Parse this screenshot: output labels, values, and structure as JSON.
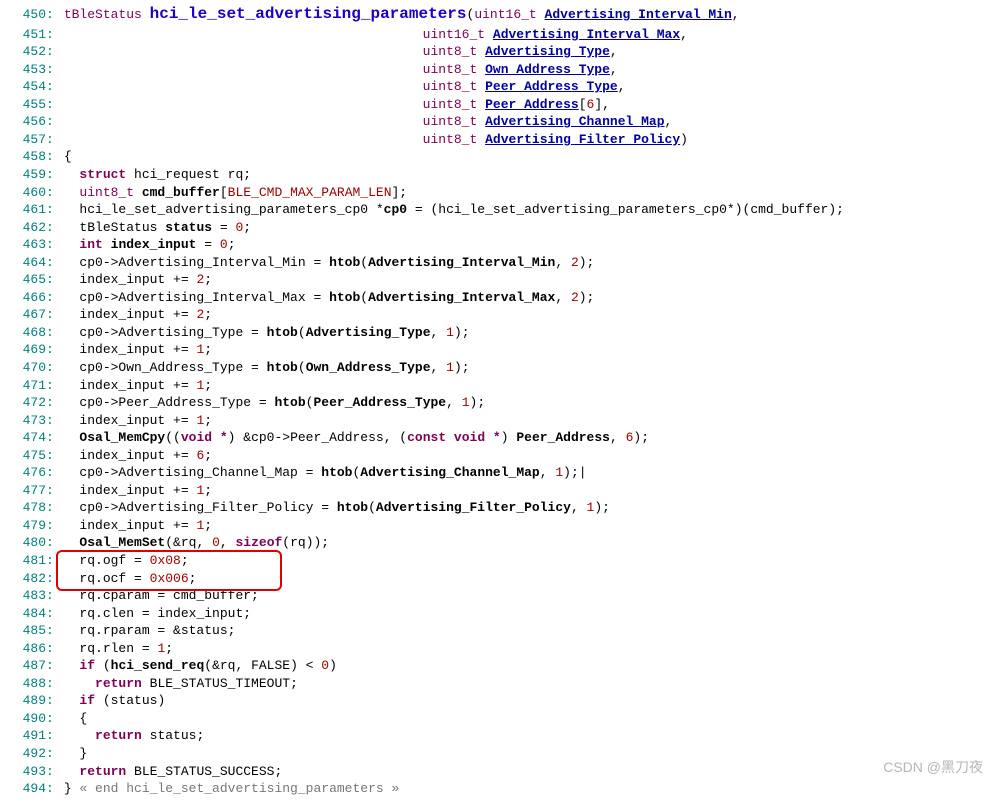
{
  "watermark": "CSDN @黑刀夜",
  "parameters": [
    {
      "type": "uint16_t",
      "name": "Advertising_Interval_Min"
    },
    {
      "type": "uint16_t",
      "name": "Advertising_Interval_Max"
    },
    {
      "type": "uint8_t",
      "name": "Advertising_Type"
    },
    {
      "type": "uint8_t",
      "name": "Own_Address_Type"
    },
    {
      "type": "uint8_t",
      "name": "Peer_Address_Type"
    },
    {
      "type": "uint8_t",
      "name": "Peer_Address",
      "array": "[6]"
    },
    {
      "type": "uint8_t",
      "name": "Advertising_Channel_Map"
    },
    {
      "type": "uint8_t",
      "name": "Advertising_Filter_Policy"
    }
  ],
  "lines": {
    "450": {
      "ret": "tBleStatus",
      "func": "hci_le_set_advertising_parameters"
    },
    "459": {
      "kw": "struct",
      "rest": " hci_request rq;"
    },
    "460": {
      "type": "uint8_t",
      "ident": " cmd_buffer",
      "macro": "BLE_CMD_MAX_PARAM_LEN"
    },
    "461": {
      "cast_type": "hci_le_set_advertising_parameters_cp0 *",
      "ident": "cp0",
      "rhs": "(hci_le_set_advertising_parameters_cp0*)(cmd_buffer);"
    },
    "462": {
      "type": "tBleStatus ",
      "ident": "status",
      "rhs": " = ",
      "num": "0"
    },
    "463": {
      "kw": "int ",
      "ident": "index_input",
      "rhs": " = ",
      "num": "0"
    },
    "464": {
      "lhs": "cp0->Advertising_Interval_Min = ",
      "fn": "htob",
      "arg": "Advertising_Interval_Min",
      "n": "2"
    },
    "465": {
      "stmt": "index_input += ",
      "num": "2"
    },
    "466": {
      "lhs": "cp0->Advertising_Interval_Max = ",
      "fn": "htob",
      "arg": "Advertising_Interval_Max",
      "n": "2"
    },
    "467": {
      "stmt": "index_input += ",
      "num": "2"
    },
    "468": {
      "lhs": "cp0->Advertising_Type = ",
      "fn": "htob",
      "arg": "Advertising_Type",
      "n": "1"
    },
    "469": {
      "stmt": "index_input += ",
      "num": "1"
    },
    "470": {
      "lhs": "cp0->Own_Address_Type = ",
      "fn": "htob",
      "arg": "Own_Address_Type",
      "n": "1"
    },
    "471": {
      "stmt": "index_input += ",
      "num": "1"
    },
    "472": {
      "lhs": "cp0->Peer_Address_Type = ",
      "fn": "htob",
      "arg": "Peer_Address_Type",
      "n": "1"
    },
    "473": {
      "stmt": "index_input += ",
      "num": "1"
    },
    "474": {
      "fn": "Osal_MemCpy",
      "castL": "void *",
      "mid": ") &cp0->Peer_Address, (",
      "castR": "const void *",
      "arg": "Peer_Address",
      "n": "6"
    },
    "475": {
      "stmt": "index_input += ",
      "num": "6"
    },
    "476": {
      "lhs": "cp0->Advertising_Channel_Map = ",
      "fn": "htob",
      "arg": "Advertising_Channel_Map",
      "n": "1",
      "cursor": "|"
    },
    "477": {
      "stmt": "index_input += ",
      "num": "1"
    },
    "478": {
      "lhs": "cp0->Advertising_Filter_Policy = ",
      "fn": "htob",
      "arg": "Advertising_Filter_Policy",
      "n": "1"
    },
    "479": {
      "stmt": "index_input += ",
      "num": "1"
    },
    "480": {
      "fn": "Osal_MemSet",
      "args_plain": "&rq, ",
      "num": "0",
      "rest": ", ",
      "kw": "sizeof",
      "tail": "(rq));"
    },
    "481": {
      "lhs": "rq.ogf = ",
      "num": "0x08"
    },
    "482": {
      "lhs": "rq.ocf = ",
      "num": "0x006"
    },
    "483": {
      "plain": "rq.cparam = cmd_buffer;"
    },
    "484": {
      "plain": "rq.clen = index_input;"
    },
    "485": {
      "plain": "rq.rparam = &status;"
    },
    "486": {
      "lhs": "rq.rlen = ",
      "num": "1"
    },
    "487": {
      "kw": "if",
      "fn": "hci_send_req",
      "arg": "&rq, FALSE",
      "cmp": " < ",
      "num": "0"
    },
    "488": {
      "kw": "return",
      "val": " BLE_STATUS_TIMEOUT;"
    },
    "489": {
      "kw": "if",
      "plain": " (status)"
    },
    "491": {
      "kw": "return",
      "val": " status;"
    },
    "493": {
      "kw": "return",
      "val": " BLE_STATUS_SUCCESS;"
    },
    "494": {
      "comment": "« end hci_le_set_advertising_parameters »"
    }
  }
}
